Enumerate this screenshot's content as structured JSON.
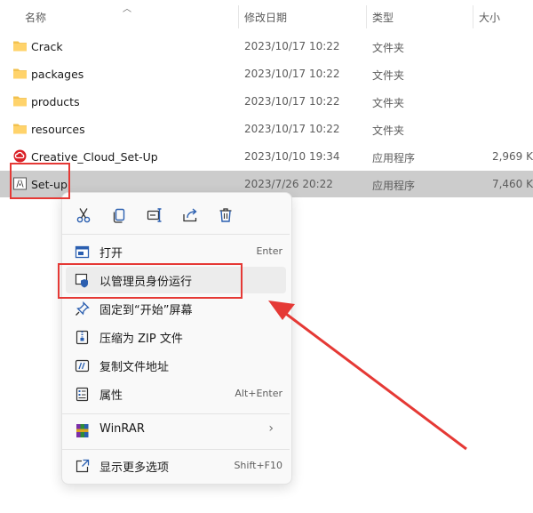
{
  "columns": {
    "name": "名称",
    "modified": "修改日期",
    "type": "类型",
    "size": "大小"
  },
  "files": [
    {
      "name": "Crack",
      "date": "2023/10/17 10:22",
      "type": "文件夹",
      "size": "",
      "icon": "folder-icon"
    },
    {
      "name": "packages",
      "date": "2023/10/17 10:22",
      "type": "文件夹",
      "size": "",
      "icon": "folder-icon"
    },
    {
      "name": "products",
      "date": "2023/10/17 10:22",
      "type": "文件夹",
      "size": "",
      "icon": "folder-icon"
    },
    {
      "name": "resources",
      "date": "2023/10/17 10:22",
      "type": "文件夹",
      "size": "",
      "icon": "folder-icon"
    },
    {
      "name": "Creative_Cloud_Set-Up",
      "date": "2023/10/10 19:34",
      "type": "应用程序",
      "size": "2,969 K",
      "icon": "creative-cloud-icon"
    },
    {
      "name": "Set-up",
      "date": "2023/7/26 20:22",
      "type": "应用程序",
      "size": "7,460 K",
      "icon": "adobe-setup-icon"
    }
  ],
  "context_menu": {
    "quick_actions": [
      "cut-icon",
      "copy-icon",
      "rename-icon",
      "share-icon",
      "delete-icon"
    ],
    "items": [
      {
        "label": "打开",
        "shortcut": "Enter"
      },
      {
        "label": "以管理员身份运行",
        "shortcut": ""
      },
      {
        "label": "固定到“开始”屏幕",
        "shortcut": ""
      },
      {
        "label": "压缩为 ZIP 文件",
        "shortcut": ""
      },
      {
        "label": "复制文件地址",
        "shortcut": ""
      },
      {
        "label": "属性",
        "shortcut": "Alt+Enter"
      },
      {
        "label": "WinRAR",
        "shortcut": ""
      },
      {
        "label": "显示更多选项",
        "shortcut": "Shift+F10"
      }
    ]
  },
  "colors": {
    "highlight": "#e53935",
    "selected_row": "#cccccc",
    "folder": "#f2c14e"
  }
}
